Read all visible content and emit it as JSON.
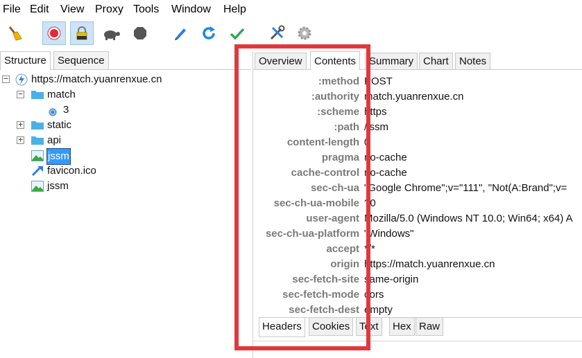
{
  "menu": [
    "File",
    "Edit",
    "View",
    "Proxy",
    "Tools",
    "Window",
    "Help"
  ],
  "toolbar": {
    "icons": [
      "broom-icon",
      "record-icon",
      "lock-icon",
      "turtle-icon",
      "stop-hex-icon",
      "pencil-icon",
      "refresh-icon",
      "check-icon",
      "tools-icon",
      "settings-gear-icon"
    ]
  },
  "left_tabs": [
    "Structure",
    "Sequence"
  ],
  "tree": {
    "root": "https://match.yuanrenxue.cn",
    "match": "match",
    "match_child": "3",
    "static": "static",
    "api": "api",
    "jssm_selected": "jssm",
    "favicon": "favicon.ico",
    "jssm": "jssm"
  },
  "right_tabs": [
    "Overview",
    "Contents",
    "Summary",
    "Chart",
    "Notes"
  ],
  "headers": [
    {
      "name": ":method",
      "value": "POST"
    },
    {
      "name": ":authority",
      "value": "match.yuanrenxue.cn"
    },
    {
      "name": ":scheme",
      "value": "https"
    },
    {
      "name": ":path",
      "value": "/jssm"
    },
    {
      "name": "content-length",
      "value": "0"
    },
    {
      "name": "pragma",
      "value": "no-cache"
    },
    {
      "name": "cache-control",
      "value": "no-cache"
    },
    {
      "name": "sec-ch-ua",
      "value": "\"Google Chrome\";v=\"111\", \"Not(A:Brand\";v="
    },
    {
      "name": "sec-ch-ua-mobile",
      "value": "?0"
    },
    {
      "name": "user-agent",
      "value": "Mozilla/5.0 (Windows NT 10.0; Win64; x64) A"
    },
    {
      "name": "sec-ch-ua-platform",
      "value": "\"Windows\""
    },
    {
      "name": "accept",
      "value": "*/*"
    },
    {
      "name": "origin",
      "value": "https://match.yuanrenxue.cn"
    },
    {
      "name": "sec-fetch-site",
      "value": "same-origin"
    },
    {
      "name": "sec-fetch-mode",
      "value": "cors"
    },
    {
      "name": "sec-fetch-dest",
      "value": "empty"
    }
  ],
  "bottom_tabs": [
    "Headers",
    "Cookies",
    "Text",
    "Hex",
    "Raw"
  ],
  "colors": {
    "highlight": "#e4363d",
    "selection": "#3399ff",
    "header_name": "#7a7a7a"
  }
}
